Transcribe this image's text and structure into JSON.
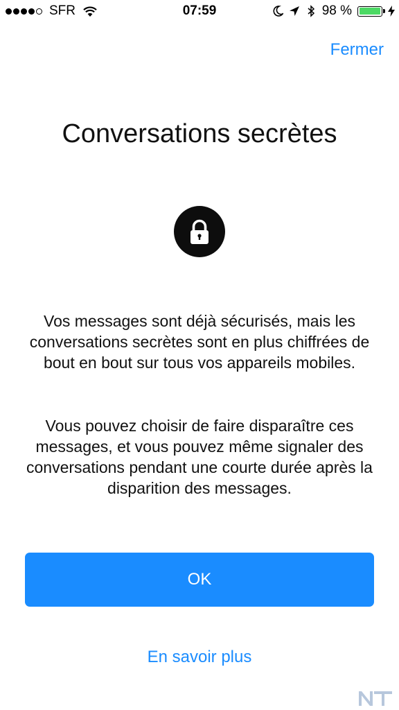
{
  "status_bar": {
    "carrier": "SFR",
    "signal_bars": 4,
    "signal_max": 5,
    "time": "07:59",
    "battery_percent": "98 %",
    "battery_level": 0.98,
    "battery_color": "#4cd964",
    "icons": [
      "wifi-icon",
      "moon-icon",
      "location-arrow-icon",
      "bluetooth-icon",
      "battery-icon",
      "charging-bolt-icon"
    ]
  },
  "header": {
    "close_label": "Fermer"
  },
  "main": {
    "title": "Conversations secrètes",
    "icon": "lock-icon",
    "paragraph_1": "Vos messages sont déjà sécurisés, mais les conversations secrètes sont en plus chiffrées de bout en bout sur tous vos appareils mobiles.",
    "paragraph_2": "Vous pouvez choisir de faire disparaître ces messages, et vous pouvez même signaler des conversations pendant une courte durée après la disparition des messages."
  },
  "actions": {
    "ok_label": "OK",
    "learn_more_label": "En savoir plus"
  },
  "colors": {
    "accent": "#1a8cff",
    "background": "#ffffff",
    "text": "#111111"
  }
}
